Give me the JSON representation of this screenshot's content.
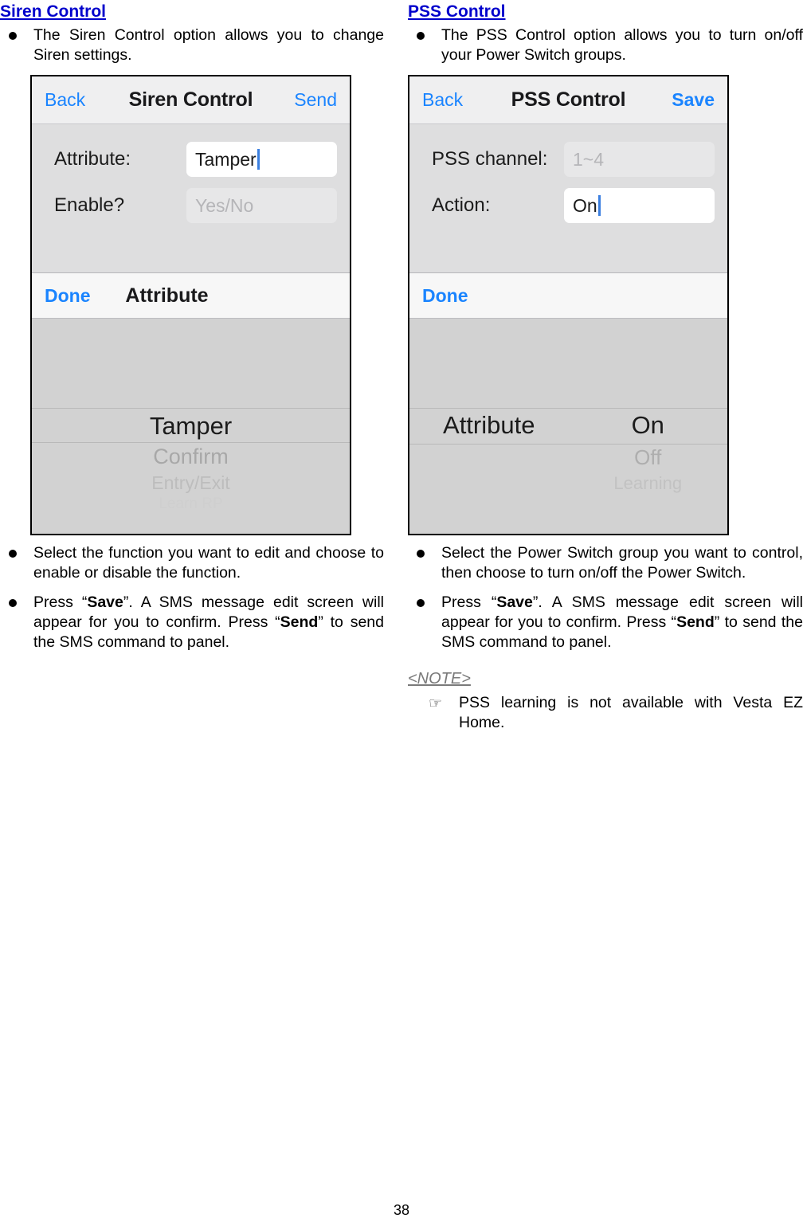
{
  "page": {
    "number": "38"
  },
  "left_column": {
    "heading": "Siren Control",
    "intro_bullet": "The Siren Control option allows you to change Siren settings.",
    "screenshot": {
      "navbar": {
        "back_label": "Back",
        "title": "Siren Control",
        "action_label": "Send"
      },
      "fields": [
        {
          "label": "Attribute:",
          "value": "Tamper",
          "state": "active"
        },
        {
          "label": "Enable?",
          "value": "Yes/No",
          "state": "placeholder"
        }
      ],
      "picker": {
        "done_label": "Done",
        "title": "Attribute",
        "selected": "Tamper",
        "option2": "Confirm",
        "option3": "Entry/Exit",
        "option4": "Learn RP"
      }
    },
    "bullets": [
      "Select the function you want to edit and choose to enable or disable the function.",
      "Press “Save”. A SMS message edit screen will appear for you to confirm.  Press “Send” to send the SMS command to panel."
    ],
    "bullet2_parts": {
      "p1": "Press “",
      "bold1": "Save",
      "p2": "”. A SMS message edit screen will appear for you to confirm.  Press “",
      "bold2": "Send",
      "p3": "” to send the SMS command to panel."
    }
  },
  "right_column": {
    "heading": "PSS Control",
    "intro_bullet": "The PSS Control option allows you to turn on/off your Power Switch groups.",
    "screenshot": {
      "navbar": {
        "back_label": "Back",
        "title": "PSS Control",
        "action_label": "Save"
      },
      "fields": [
        {
          "label": "PSS channel:",
          "value": "1~4",
          "state": "placeholder"
        },
        {
          "label": "Action:",
          "value": "On",
          "state": "active"
        }
      ],
      "picker": {
        "done_label": "Done",
        "title": "",
        "left_selected": "Attribute",
        "right_selected": "On",
        "right_option2": "Off",
        "right_option3": "Learning"
      }
    },
    "bullets": [
      "Select the Power Switch group you want to control, then choose to turn on/off the Power Switch.",
      "Press “Save”. A SMS message edit screen will appear for you to confirm.  Press “Send” to send the SMS command to panel."
    ],
    "bullet2_parts": {
      "p1": "Press “",
      "bold1": "Save",
      "p2": "”. A SMS message edit screen will appear for you to confirm.  Press “",
      "bold2": "Send",
      "p3": "” to send the SMS command to panel."
    },
    "note": {
      "title": "<NOTE>",
      "hand_icon": "☞",
      "item": "PSS learning is not available with Vesta EZ Home."
    }
  },
  "colors": {
    "heading_blue": "#0000CC",
    "ios_blue": "#1a84ff",
    "caret_blue": "#3b7fe0",
    "note_gray": "#7a7a7a"
  }
}
